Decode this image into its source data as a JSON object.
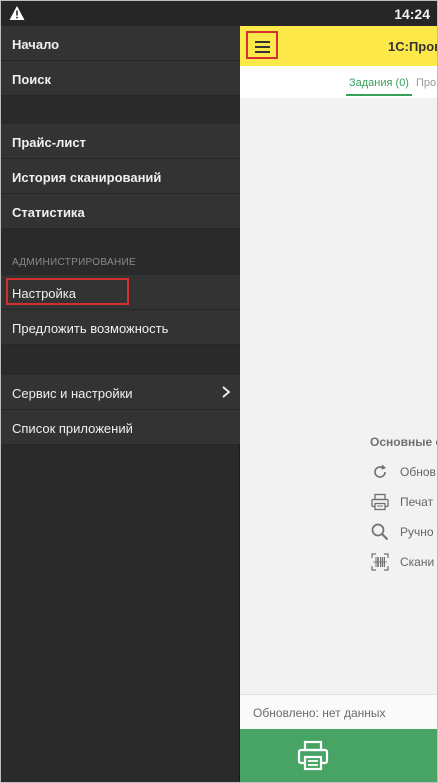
{
  "status_bar": {
    "time": "14:24",
    "warning_icon": "warning-triangle-icon"
  },
  "app": {
    "title": "1С:Пров",
    "tabs": {
      "tasks_label": "Задания (0)",
      "other_label": "Про"
    },
    "section_title": "Основные с",
    "actions": [
      {
        "label": "Обнов",
        "icon": "refresh-icon"
      },
      {
        "label": "Печат",
        "icon": "printer-icon"
      },
      {
        "label": "Ручно",
        "icon": "search-icon"
      },
      {
        "label": "Скани",
        "icon": "barcode-scan-icon"
      }
    ],
    "updated_text": "Обновлено: нет данных",
    "print_button_icon": "printer-icon",
    "accent_color": "#fde84a",
    "green_color": "#48a464"
  },
  "drawer": {
    "group1": [
      {
        "label": "Начало"
      },
      {
        "label": "Поиск"
      }
    ],
    "group2": [
      {
        "label": "Прайс-лист"
      },
      {
        "label": "История сканирований"
      },
      {
        "label": "Статистика"
      }
    ],
    "admin_header": "АДМИНИСТРИРОВАНИЕ",
    "admin_items": [
      {
        "label": "Настройка"
      },
      {
        "label": "Предложить возможность"
      }
    ],
    "group3": [
      {
        "label": "Сервис и настройки"
      },
      {
        "label": "Список приложений"
      }
    ]
  }
}
